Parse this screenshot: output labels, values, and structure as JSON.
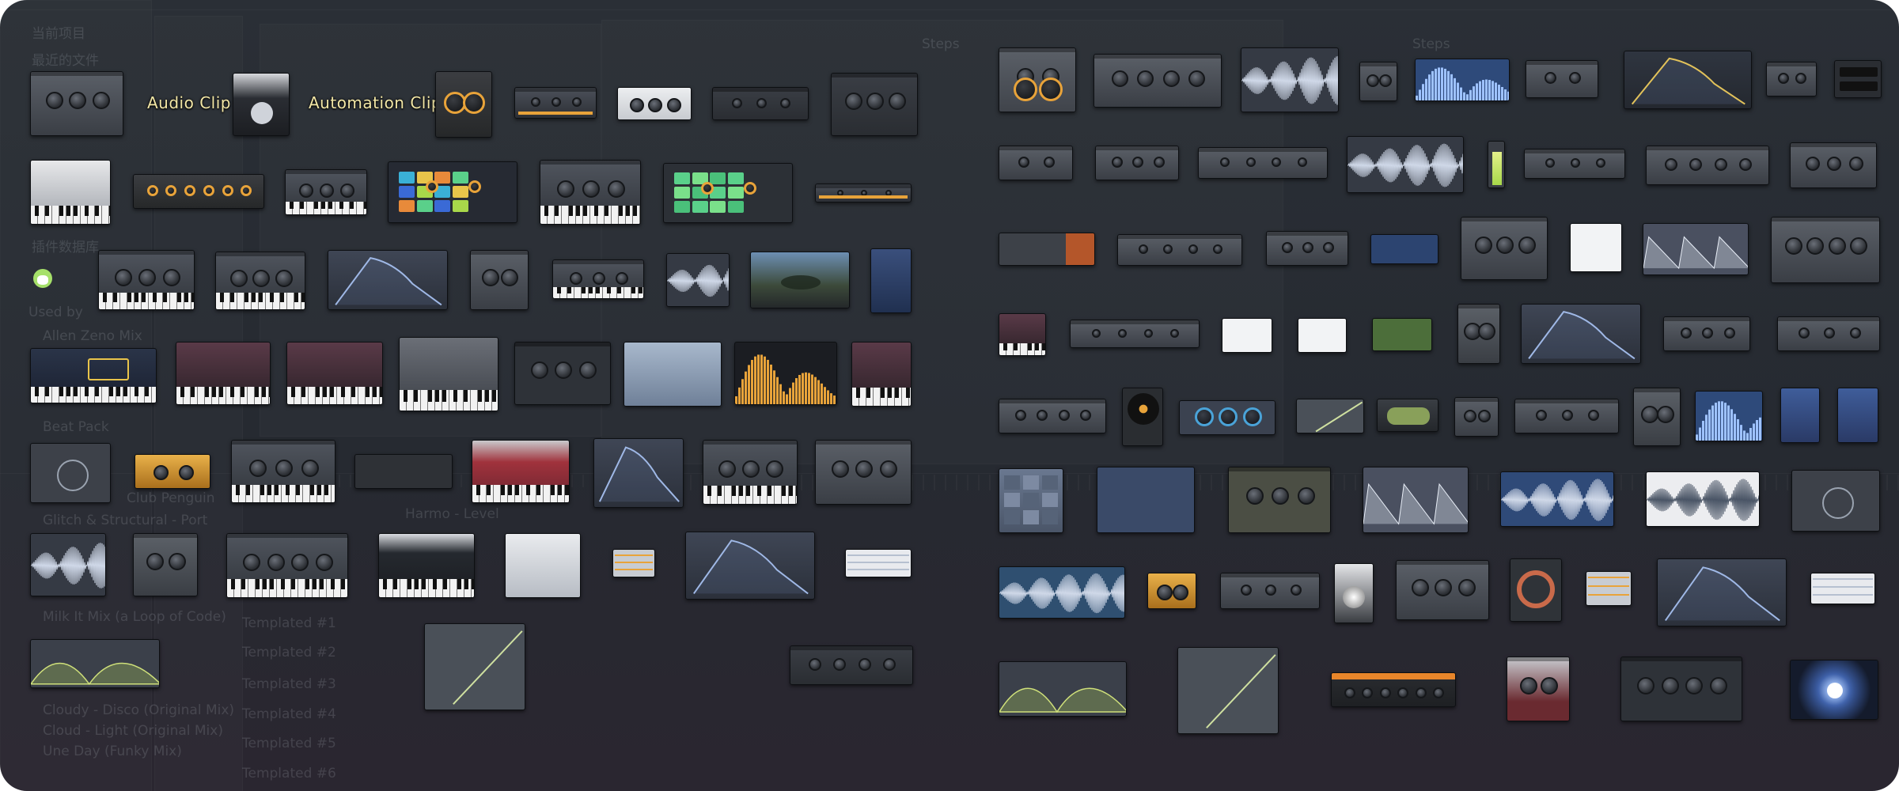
{
  "labels": {
    "audio_clip": "Audio Clip",
    "automation_clip": "Automation Clip"
  },
  "background_text": {
    "browser_current_project": "当前项目",
    "browser_recent_files": "最近的文件",
    "browser_plugin_db": "插件数据库",
    "sidebar_used_by": "Used by",
    "bg_sample_1": "Allen Zeno Mix",
    "bg_sample_2": "Beat Pack",
    "bg_sample_3": "Club Penguin",
    "bg_sample_4": "Glitch & Structural - Port",
    "bg_sample_5": "Milk It Mix (a Loop of Code)",
    "bg_sample_6": "Cloudy - Disco (Original Mix)",
    "bg_sample_7": "Cloud - Light (Original Mix)",
    "bg_sample_8": "Une Day (Funky Mix)",
    "playlist_row_1": "Templated #1",
    "playlist_row_2": "Templated #2",
    "playlist_row_3": "Templated #3",
    "playlist_row_4": "Templated #4",
    "playlist_row_5": "Templated #5",
    "playlist_row_6": "Templated #6",
    "step_label_1": "Steps",
    "step_label_2": "Steps",
    "harmo_label": "Harmo - Level"
  },
  "colors": {
    "frame_bg": "#272b32",
    "label_text": "#f3e7a6",
    "accent_green": "#a8d84a",
    "accent_orange": "#e8a33a",
    "accent_blue": "#4aa3d8",
    "accent_red": "#c23a4a"
  },
  "icons": {
    "mascot": "fl-chan-mascot-icon",
    "automation": "automation-clip-icon",
    "audio": "audio-clip-plugin-thumbnail"
  }
}
